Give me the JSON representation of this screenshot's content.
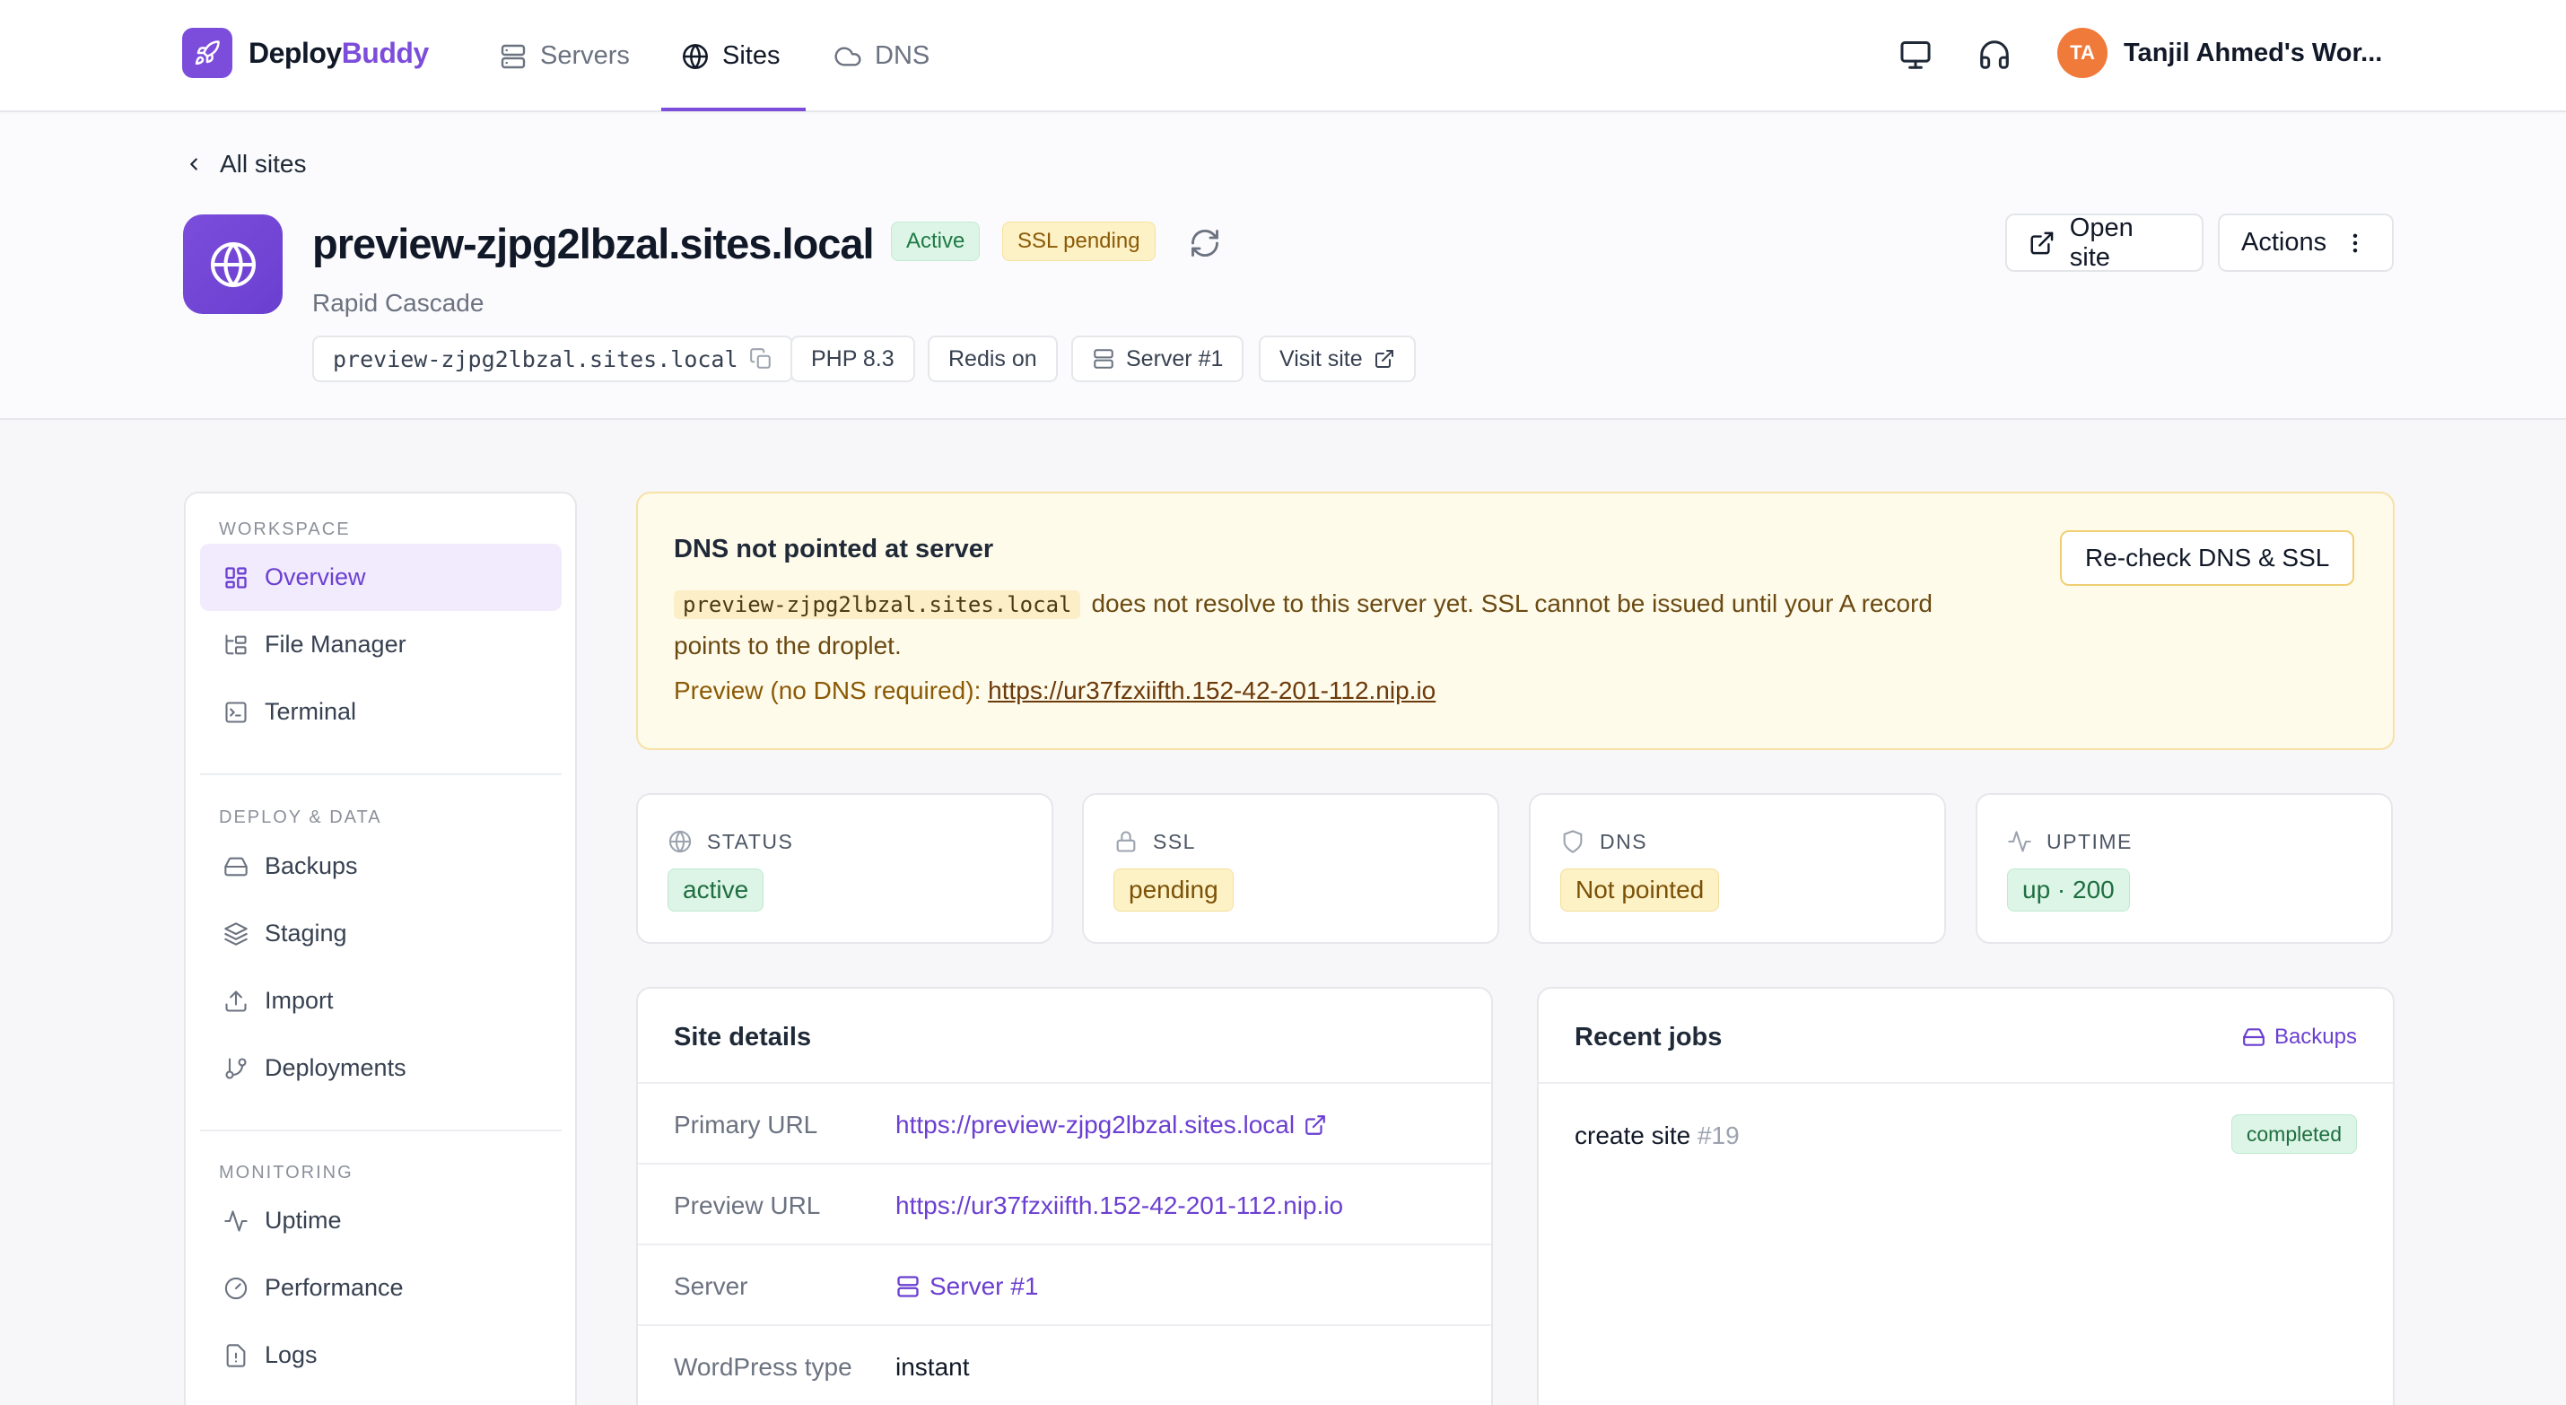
{
  "nav": {
    "brand_part1": "Deploy",
    "brand_part2": "Buddy",
    "links": [
      {
        "label": "Servers",
        "icon": "server-icon",
        "active": false
      },
      {
        "label": "Sites",
        "icon": "globe-icon",
        "active": true
      },
      {
        "label": "DNS",
        "icon": "cloud-icon",
        "active": false
      }
    ],
    "user_initials": "TA",
    "user_name": "Tanjil Ahmed's Wor..."
  },
  "header": {
    "back_label": "All sites",
    "site_name": "preview-zjpg2lbzal.sites.local",
    "status_badge": "Active",
    "ssl_badge": "SSL pending",
    "subtitle": "Rapid Cascade",
    "chips": {
      "domain": "preview-zjpg2lbzal.sites.local",
      "php": "PHP 8.3",
      "redis": "Redis on",
      "server": "Server #1",
      "visit": "Visit site"
    },
    "open_site": "Open site",
    "actions": "Actions"
  },
  "sidebar": {
    "sections": [
      {
        "title": "WORKSPACE",
        "items": [
          "Overview",
          "File Manager",
          "Terminal"
        ]
      },
      {
        "title": "DEPLOY & DATA",
        "items": [
          "Backups",
          "Staging",
          "Import",
          "Deployments"
        ]
      },
      {
        "title": "MONITORING",
        "items": [
          "Uptime",
          "Performance",
          "Logs"
        ]
      }
    ],
    "active_item": "Overview"
  },
  "alert": {
    "title": "DNS not pointed at server",
    "domain": "preview-zjpg2lbzal.sites.local",
    "message": "does not resolve to this server yet. SSL cannot be issued until your A record points to the droplet.",
    "preview_label": "Preview (no DNS required):",
    "preview_url": "https://ur37fzxiifth.152-42-201-112.nip.io",
    "button": "Re-check DNS & SSL"
  },
  "stats": [
    {
      "label": "STATUS",
      "value": "active",
      "tone": "green"
    },
    {
      "label": "SSL",
      "value": "pending",
      "tone": "amber"
    },
    {
      "label": "DNS",
      "value": "Not pointed",
      "tone": "amber"
    },
    {
      "label": "UPTIME",
      "value": "up · 200",
      "tone": "green"
    }
  ],
  "details": {
    "title": "Site details",
    "rows": [
      {
        "key": "Primary URL",
        "value": "https://preview-zjpg2lbzal.sites.local"
      },
      {
        "key": "Preview URL",
        "value": "https://ur37fzxiifth.152-42-201-112.nip.io"
      },
      {
        "key": "Server",
        "value": "Server #1"
      },
      {
        "key": "WordPress type",
        "value": "instant"
      }
    ]
  },
  "jobs": {
    "title": "Recent jobs",
    "link": "Backups",
    "items": [
      {
        "name": "create site",
        "number": "#19",
        "status": "completed"
      }
    ]
  },
  "colors": {
    "accent": "#7c4ddb",
    "success_bg": "#dcf5e6",
    "warning_bg": "#fdf1c6"
  }
}
